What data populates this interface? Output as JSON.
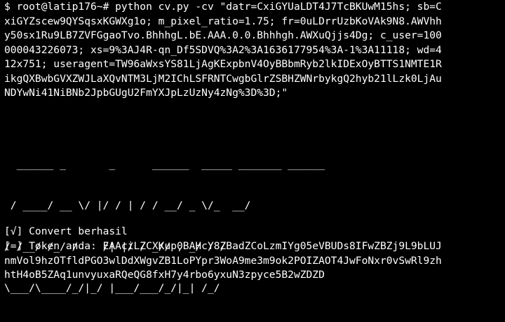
{
  "terminal": {
    "command_lines": [
      "$ root@latip176~# python cv.py -cv \"datr=CxiGYUaLDT4J7TcBKUwM15hs; sb=C",
      "xiGYZscew9QYSqsxKGWXg1o; m_pixel_ratio=1.75; fr=0uLDrrUzbKoVAk9N8.AWVhh",
      "y50sx1Ru9LB7ZVFGgaoTvo.BhhhgL.bE.AAA.0.0.Bhhhgh.AWXuQjjs4Dg; c_user=100",
      "000043226073; xs=9%3AJ4R-qn_Df5SDVQ%3A2%3A1636177954%3A-1%3A11118; wd=4",
      "12x751; useragent=TW96aWxsYS81LjAgKExpbnV4OyBBbmRyb2lkIDExOyBTTS1NMTE1R",
      "ikgQXBwbGVXZWJLaXQvNTM3LjM2IChLSFRNTCwgbGlrZSBHZWNrbykgQ2hyb21lLzk0LjAu",
      "NDYwNi41NiBNb2JpbGUgU2FmYXJpLzUzNy4zNg%3D%3D;\""
    ],
    "banner_lines": [
      "  ______ _       _      ______  _____ _______ ______",
      " / ____/ __ \\/ |/ / | / / __/ _ \\/_  __/",
      "/ /__/ /_/ /    /| |/ / _// , _/ / /",
      "\\___/\\____/_/|_/ |___/___/_/|_| /_/"
    ],
    "status": "[√] Convert berhasil",
    "token_lines": [
      "[=] Token anda: EAAciLZCXKup0BAHcY8ZBadZCoLzmIYg05eVBUDs8IFwZBZj9L9bLUJ",
      "nmVol9hzOTfldPGO3wlDdXWgvZB1LoPYpr3WoA9me3m9ok2POIZAOT4JwFoNxr0vSwRl9zh",
      "htH4oB5ZAq1unvyuxaRQeQG8fxH7y4rbo6yxuN3zpyce5B2wZDZD"
    ]
  }
}
